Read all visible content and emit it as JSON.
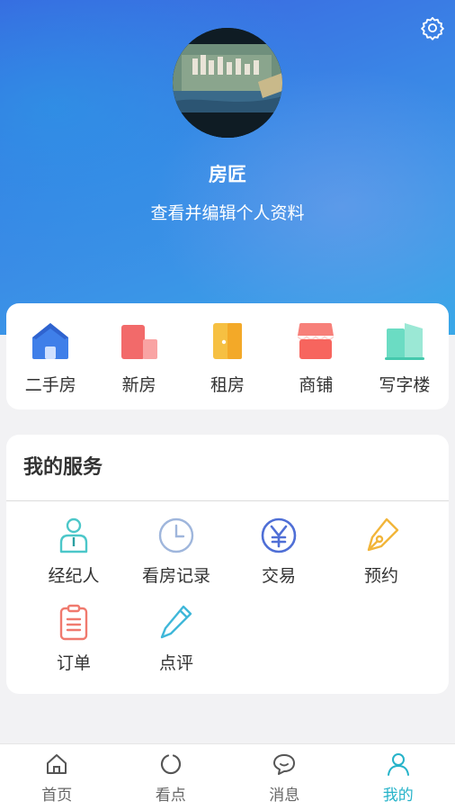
{
  "profile": {
    "name": "房匠",
    "edit_text": "查看并编辑个人资料"
  },
  "categories": [
    {
      "label": "二手房",
      "icon": "house-icon"
    },
    {
      "label": "新房",
      "icon": "building-icon"
    },
    {
      "label": "租房",
      "icon": "door-icon"
    },
    {
      "label": "商铺",
      "icon": "shop-icon"
    },
    {
      "label": "写字楼",
      "icon": "office-building-icon"
    }
  ],
  "services": {
    "title": "我的服务",
    "items": [
      {
        "label": "经纪人",
        "icon": "agent-icon"
      },
      {
        "label": "看房记录",
        "icon": "clock-icon"
      },
      {
        "label": "交易",
        "icon": "yen-icon"
      },
      {
        "label": "预约",
        "icon": "pen-nib-icon"
      },
      {
        "label": "订单",
        "icon": "clipboard-icon"
      },
      {
        "label": "点评",
        "icon": "pencil-icon"
      }
    ]
  },
  "tabbar": {
    "items": [
      {
        "label": "首页",
        "icon": "home-icon"
      },
      {
        "label": "看点",
        "icon": "circle-icon"
      },
      {
        "label": "消息",
        "icon": "chat-icon"
      },
      {
        "label": "我的",
        "icon": "user-icon",
        "active": true
      }
    ]
  },
  "colors": {
    "accent": "#26b3c9",
    "header_top": "#3a62e0",
    "header_bottom": "#3aa8e8"
  }
}
